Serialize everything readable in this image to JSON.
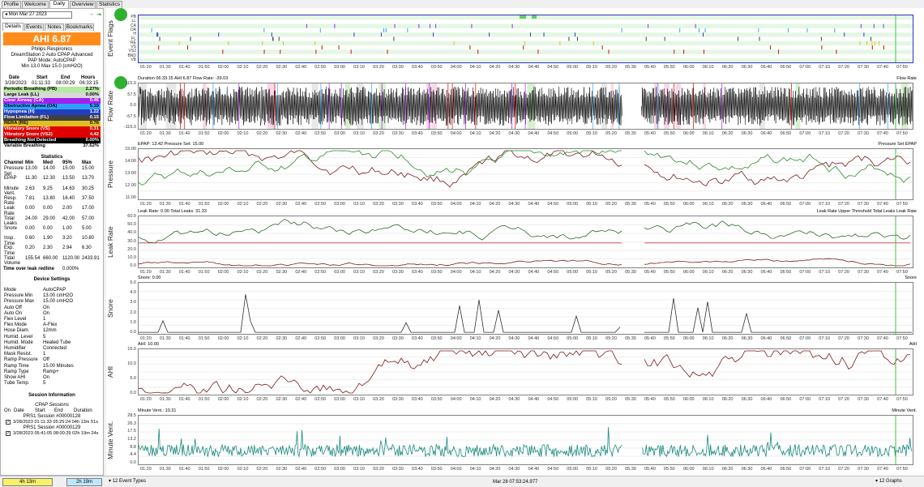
{
  "tabs": [
    "Profile",
    "Welcome",
    "Daily",
    "Overview",
    "Statistics"
  ],
  "nav": {
    "prev_icon": "◂",
    "date": "Mon Mar 27 2023",
    "next_icon": "→",
    "last_icon": "⇥"
  },
  "subtabs": [
    "Details",
    "Events",
    "Notes",
    "Bookmarks"
  ],
  "ahi": "AHI 6.87",
  "machine": {
    "brand": "Philips Respironics",
    "model": "DreamStation 2 Auto CPAP Advanced",
    "mode": "PAP Mode: AutoCPAP",
    "range": "Min 13.0 Max 15.0 (cmH2O)"
  },
  "session_hdr": {
    "date": "Date",
    "start": "Start",
    "end": "End",
    "hours": "Hours"
  },
  "session_vals": {
    "date": "3/28/2023",
    "start": "01:11:33",
    "end": "08:00:29",
    "hours": "06:33:15"
  },
  "events": [
    {
      "label": "Periodic Breathing (PB)",
      "value": "2.27%",
      "bg": "#b5e8a0",
      "fg": "#000"
    },
    {
      "label": "Large Leak (LL)",
      "value": "0.00%",
      "bg": "#d8d8d8",
      "fg": "#000"
    },
    {
      "label": "Clear Airway (CA)",
      "value": "0.46",
      "bg": "#a020f0",
      "fg": "#fff"
    },
    {
      "label": "Obstructive Apnea (OA)",
      "value": "5.19",
      "bg": "#30a0ff",
      "fg": "#000"
    },
    {
      "label": "Hypopnea (H)",
      "value": "1.22",
      "bg": "#2040c0",
      "fg": "#fff"
    },
    {
      "label": "Flow Limitation (FL)",
      "value": "0.15",
      "bg": "#404040",
      "fg": "#fff"
    },
    {
      "label": "RERA (RE)",
      "value": "0.76",
      "bg": "#e0c020",
      "fg": "#000"
    },
    {
      "label": "Vibratory Snore (VS)",
      "value": "0.31",
      "bg": "#e00000",
      "fg": "#fff"
    },
    {
      "label": "Vibratory Snore (VS2)",
      "value": "4.42",
      "bg": "#e00000",
      "fg": "#fff"
    },
    {
      "label": "Breathing Not Detected",
      "value": "0.00%",
      "bg": "#000000",
      "fg": "#fff"
    },
    {
      "label": "Variable Breathing",
      "value": "37.62%",
      "bg": "#ffffff",
      "fg": "#000"
    }
  ],
  "stats": {
    "title": "Statistics",
    "headers": [
      "Channel",
      "Min",
      "Med",
      "95%",
      "Max"
    ],
    "rows": [
      [
        "Pressure Set",
        "13.00",
        "14.00",
        "15.00",
        "15.00"
      ],
      [
        "EPAP",
        "11.30",
        "12.30",
        "13.50",
        "13.70"
      ],
      [
        "Minute Vent.",
        "2.63",
        "9.25",
        "14.63",
        "30.25"
      ],
      [
        "Resp. Rate",
        "7.81",
        "13.80",
        "16.40",
        "37.50"
      ],
      [
        "Leak Rate",
        "0.00",
        "0.00",
        "2.00",
        "17.00"
      ],
      [
        "Total Leaks",
        "24.00",
        "29.00",
        "42.00",
        "57.00"
      ],
      [
        "Snore",
        "0.00",
        "0.00",
        "1.00",
        "5.00"
      ],
      [
        "Insp. Time",
        "0.60",
        "1.90",
        "3.20",
        "10.80"
      ],
      [
        "Exp. Time",
        "0.20",
        "2.30",
        "2.94",
        "6.30"
      ],
      [
        "Tidal Volume",
        "155.54",
        "660.00",
        "1120.00",
        "2433.91"
      ]
    ]
  },
  "leak_redline": {
    "label": "Time over leak redline",
    "value": "0.000%"
  },
  "device": {
    "title": "Device Settings",
    "rows": [
      [
        "Mode",
        "AutoCPAP"
      ],
      [
        "Pressure Min",
        "13.00 cmH2O"
      ],
      [
        "Pressure Max",
        "15.00 cmH2O"
      ],
      [
        "Auto Off",
        "On"
      ],
      [
        "Auto On",
        "On"
      ],
      [
        "Flex Level",
        "1"
      ],
      [
        "Flex Mode",
        "A-Flex"
      ],
      [
        "Hose Diam.",
        "12mm"
      ],
      [
        "Humid. Level",
        "5"
      ],
      [
        "Humid. Mode",
        "Heated Tube"
      ],
      [
        "Humidifier",
        "Connected"
      ],
      [
        "Mask Resist.",
        "1"
      ],
      [
        "Ramp Pressure",
        "Off"
      ],
      [
        "Ramp Time",
        "15.00 Minutes"
      ],
      [
        "Ramp Type",
        "Ramp+"
      ],
      [
        "Show AHI",
        "On"
      ],
      [
        "Tube Temp.",
        "5"
      ]
    ]
  },
  "session_info": {
    "title": "Session Information",
    "subtitle": "CPAP Sessions",
    "headers": [
      "On",
      "Date",
      "Start",
      "End",
      "Duration"
    ],
    "sessions": [
      {
        "id": "PRS1 Session #00000128",
        "line": "3/28/2023 01:11:33 05:25:24 04h 13m 51s"
      },
      {
        "id": "PRS1 Session #00000129",
        "line": "3/28/2023 05:41:05 08:00:29 02h 19m 24s"
      }
    ]
  },
  "bottom": {
    "btn1": "4h 13m",
    "btn2": "2h 19m",
    "event_types": "12 Event Types",
    "timestamp": "Mar 28 07:53:24.977",
    "graphs": "12 Graphs"
  },
  "time_ticks": [
    "01:20",
    "01:30",
    "01:40",
    "01:50",
    "02:00",
    "02:10",
    "02:20",
    "02:30",
    "02:40",
    "02:50",
    "03:00",
    "03:10",
    "03:20",
    "03:30",
    "03:40",
    "03:50",
    "04:00",
    "04:10",
    "04:20",
    "04:30",
    "04:40",
    "04:50",
    "05:00",
    "05:10",
    "05:20",
    "05:30",
    "05:40",
    "05:50",
    "06:00",
    "06:10",
    "06:20",
    "06:30",
    "06:40",
    "06:50",
    "07:00",
    "07:10",
    "07:20",
    "07:30",
    "07:40",
    "07:50"
  ],
  "graphs": {
    "flags": {
      "ylabel": "Event Flags",
      "rows": [
        "PB",
        "LL",
        "CA",
        "OA",
        "H",
        "FL",
        "RE",
        "VS",
        "VS2",
        "BND",
        "VB"
      ]
    },
    "flow": {
      "ylabel": "Flow Rate",
      "header": "Duration 06:33:15 AHI 6.87 Flow Rate: -39.03",
      "legend": "Flow Rate",
      "yticks": [
        "115.0",
        "57.5",
        "0.0",
        "-57.5",
        "-115.0"
      ]
    },
    "pressure": {
      "ylabel": "Pressure",
      "header": "EPAP: 13.42 Pressure Set: 15.00",
      "legend": "Pressure Set EPAP",
      "yticks": [
        "15.00",
        "14.00",
        "13.00",
        "12.00",
        "11.00"
      ]
    },
    "leak": {
      "ylabel": "Leak Rate",
      "header": "Leak Rate: 0.00 Total Leaks: 31.33",
      "legend": "Leak Rate Upper Threshold  Total Leaks  Leak Rate",
      "yticks": [
        "60.0",
        "50.0",
        "40.0",
        "30.0",
        "20.0",
        "10.0",
        "0.0"
      ]
    },
    "snore": {
      "ylabel": "Snore",
      "header": "Snore: 0.00",
      "legend": "Snore",
      "yticks": [
        "5.0",
        "4.0",
        "3.0",
        "2.0",
        "1.0",
        "0.0"
      ]
    },
    "ahi": {
      "ylabel": "AHI",
      "header": "AHI: 10.00",
      "legend": "AHI",
      "yticks": [
        "15.0",
        "10.0",
        "5.0",
        "0.0"
      ]
    },
    "minvent": {
      "ylabel": "Minute Vent.",
      "header": "Minute Vent.: 10.31",
      "legend": "Minute Vent.",
      "yticks": [
        "28.5",
        "26.3",
        "17.5",
        "13.2",
        "8.8",
        "4.4",
        "0.0"
      ]
    }
  },
  "colors": {
    "pressure_set": "#7a1a1a",
    "epap": "#2a8a2a",
    "leak_total": "#2a6a2a",
    "leak_rate": "#7a1a1a",
    "threshold": "#d04040",
    "snore": "#303030",
    "ahi": "#7a1a1a",
    "minvent": "#1a8a80",
    "flow": "#000000",
    "cursor": "#40c040"
  }
}
